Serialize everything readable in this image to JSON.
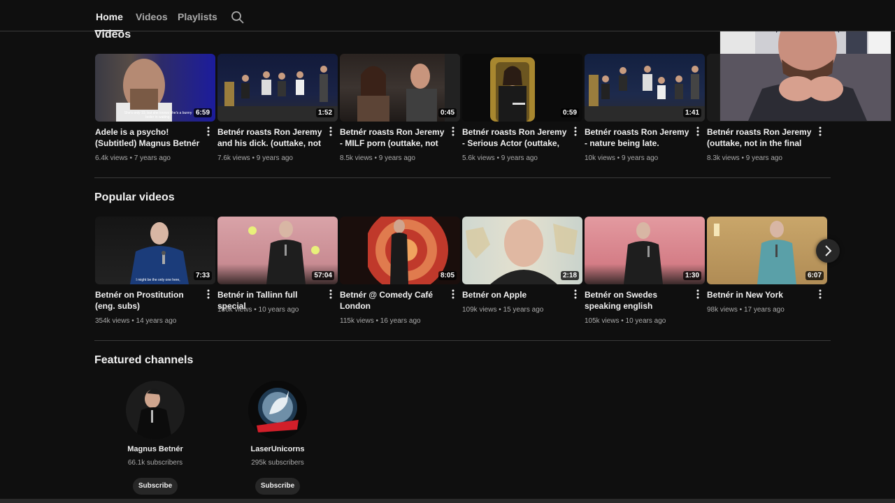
{
  "nav": {
    "tabs": [
      {
        "label": "Home",
        "active": true
      },
      {
        "label": "Videos",
        "active": false
      },
      {
        "label": "Playlists",
        "active": false
      }
    ],
    "search_icon": "search-icon"
  },
  "sections": {
    "videos": {
      "title": "Videos",
      "items": [
        {
          "title": "Adele is a psycho! (Subtitled) Magnus Betnér",
          "duration": "6:59",
          "meta": "6.4k views • 7 years ago",
          "caption": "She's only 19, but she knows she's a bunny boiler in waiting."
        },
        {
          "title": "Betnér roasts Ron Jeremy and his dick. (outtake, not i...",
          "duration": "1:52",
          "meta": "7.6k views • 9 years ago"
        },
        {
          "title": "Betnér roasts Ron Jeremy - MILF porn (outtake, not in t...",
          "duration": "0:45",
          "meta": "8.5k views • 9 years ago"
        },
        {
          "title": "Betnér roasts Ron Jeremy - Serious Actor (outtake, not i...",
          "duration": "0:59",
          "meta": "5.6k views • 9 years ago"
        },
        {
          "title": "Betnér roasts Ron Jeremy - nature being late. (outtake,...",
          "duration": "1:41",
          "meta": "10k views • 9 years ago"
        },
        {
          "title": "Betnér roasts Ron Jeremy (outtake, not in the final edit.)",
          "duration": "",
          "meta": "8.3k views • 9 years ago"
        }
      ]
    },
    "popular": {
      "title": "Popular videos",
      "items": [
        {
          "title": "Betnér on Prostitution (eng. subs)",
          "duration": "7:33",
          "meta": "354k views • 14 years ago",
          "caption": "I might be the only one here,"
        },
        {
          "title": "Betnér in Tallinn full special",
          "duration": "57:04",
          "meta": "186k views • 10 years ago"
        },
        {
          "title": "Betnér @ Comedy Café London",
          "duration": "8:05",
          "meta": "115k views • 16 years ago"
        },
        {
          "title": "Betnér on Apple",
          "duration": "2:18",
          "meta": "109k views • 15 years ago"
        },
        {
          "title": "Betnér on Swedes speaking english",
          "duration": "1:30",
          "meta": "105k views • 10 years ago"
        },
        {
          "title": "Betnér in New York",
          "duration": "6:07",
          "meta": "98k views • 17 years ago"
        }
      ]
    },
    "featured": {
      "title": "Featured channels",
      "channels": [
        {
          "name": "Magnus Betnér",
          "subs": "66.1k subscribers",
          "button": "Subscribe"
        },
        {
          "name": "LaserUnicorns",
          "subs": "295k subscribers",
          "button": "Subscribe"
        }
      ]
    }
  },
  "icons": {
    "more": "more-vert-icon",
    "next": "chevron-right-icon"
  }
}
